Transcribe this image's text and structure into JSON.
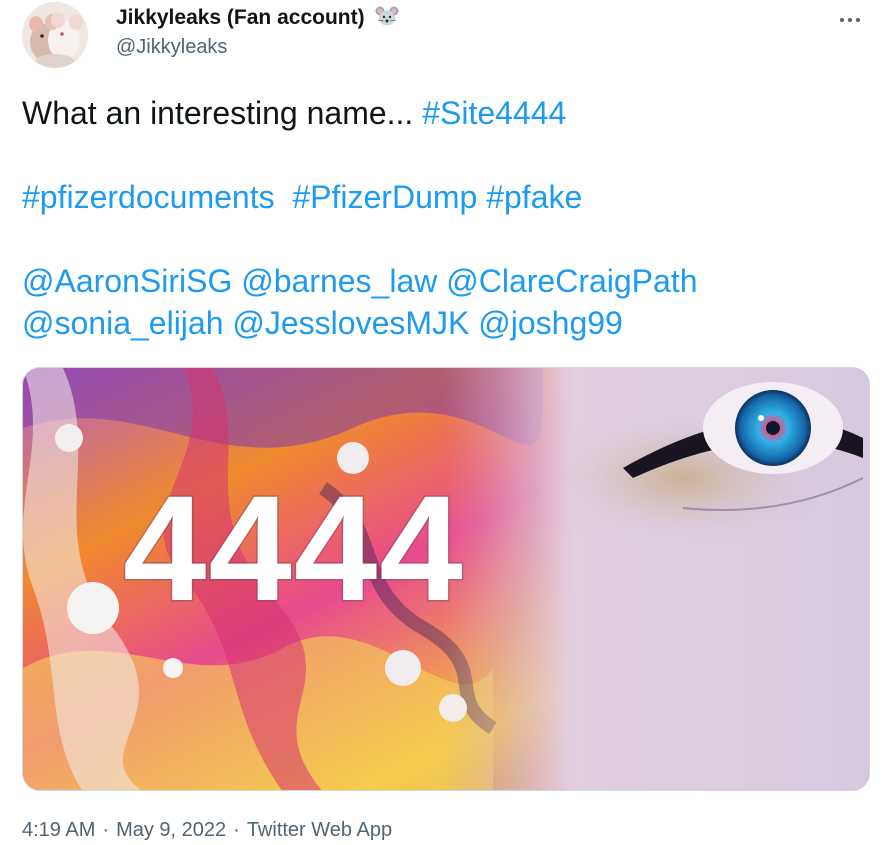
{
  "author": {
    "display_name": "Jikkyleaks (Fan account)",
    "handle": "@Jikkyleaks"
  },
  "icons": {
    "avatar": "mice-photo",
    "name_emoji": "mouse-face-icon",
    "more": "more-dots-icon"
  },
  "tweet": {
    "line1_text": "What an interesting name... ",
    "line1_hashtag": "#Site4444",
    "line2_hashtags": [
      "#pfizerdocuments",
      "#PfizerDump",
      "#pfake"
    ],
    "line3_mentions": [
      "@AaronSiriSG",
      "@barnes_law",
      "@ClareCraigPath"
    ],
    "line4_mentions": [
      "@sonia_elijah",
      "@JesslovesMJK",
      "@joshg99"
    ]
  },
  "media": {
    "overlay_text": "4444"
  },
  "meta": {
    "time": "4:19 AM",
    "date": "May 9, 2022",
    "source": "Twitter Web App"
  },
  "colors": {
    "link": "#1d9bf0",
    "secondary_text": "#536471",
    "primary_text": "#0f1419",
    "border": "#cfd9de"
  }
}
